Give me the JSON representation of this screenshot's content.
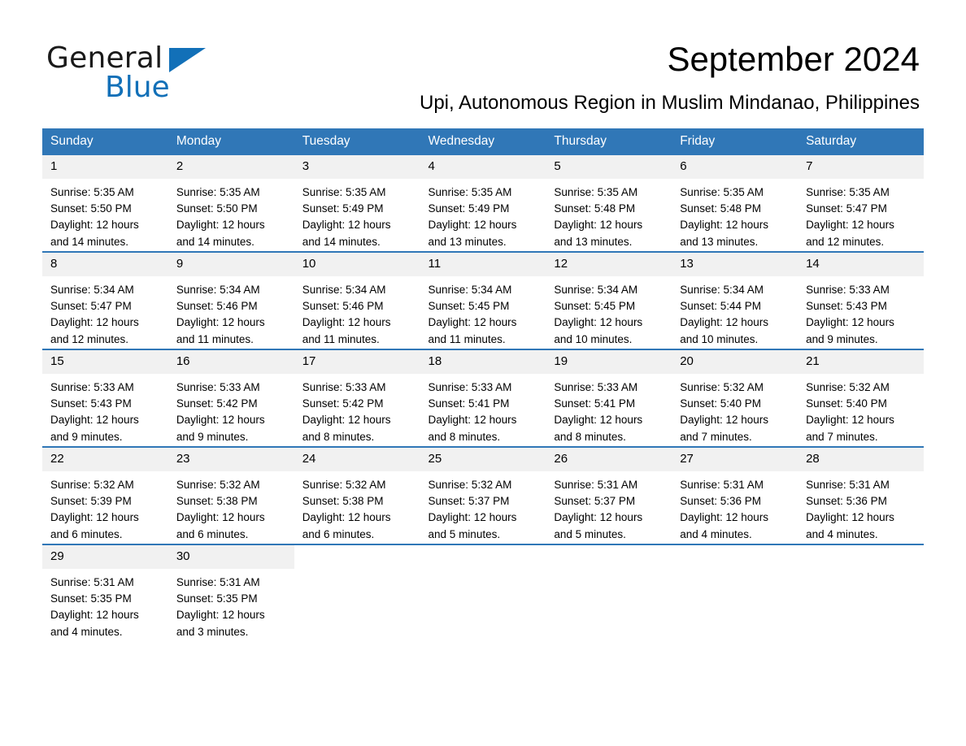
{
  "brand": {
    "word_general": "General",
    "word_blue": "Blue",
    "triangle_color": "#1270b8",
    "accent_color": "#3077b7"
  },
  "header": {
    "title": "September 2024",
    "subtitle": "Upi, Autonomous Region in Muslim Mindanao, Philippines"
  },
  "calendar": {
    "weekday_headers": [
      "Sunday",
      "Monday",
      "Tuesday",
      "Wednesday",
      "Thursday",
      "Friday",
      "Saturday"
    ],
    "weeks": [
      [
        {
          "day": "1",
          "sunrise": "Sunrise: 5:35 AM",
          "sunset": "Sunset: 5:50 PM",
          "daylight_l1": "Daylight: 12 hours",
          "daylight_l2": "and 14 minutes."
        },
        {
          "day": "2",
          "sunrise": "Sunrise: 5:35 AM",
          "sunset": "Sunset: 5:50 PM",
          "daylight_l1": "Daylight: 12 hours",
          "daylight_l2": "and 14 minutes."
        },
        {
          "day": "3",
          "sunrise": "Sunrise: 5:35 AM",
          "sunset": "Sunset: 5:49 PM",
          "daylight_l1": "Daylight: 12 hours",
          "daylight_l2": "and 14 minutes."
        },
        {
          "day": "4",
          "sunrise": "Sunrise: 5:35 AM",
          "sunset": "Sunset: 5:49 PM",
          "daylight_l1": "Daylight: 12 hours",
          "daylight_l2": "and 13 minutes."
        },
        {
          "day": "5",
          "sunrise": "Sunrise: 5:35 AM",
          "sunset": "Sunset: 5:48 PM",
          "daylight_l1": "Daylight: 12 hours",
          "daylight_l2": "and 13 minutes."
        },
        {
          "day": "6",
          "sunrise": "Sunrise: 5:35 AM",
          "sunset": "Sunset: 5:48 PM",
          "daylight_l1": "Daylight: 12 hours",
          "daylight_l2": "and 13 minutes."
        },
        {
          "day": "7",
          "sunrise": "Sunrise: 5:35 AM",
          "sunset": "Sunset: 5:47 PM",
          "daylight_l1": "Daylight: 12 hours",
          "daylight_l2": "and 12 minutes."
        }
      ],
      [
        {
          "day": "8",
          "sunrise": "Sunrise: 5:34 AM",
          "sunset": "Sunset: 5:47 PM",
          "daylight_l1": "Daylight: 12 hours",
          "daylight_l2": "and 12 minutes."
        },
        {
          "day": "9",
          "sunrise": "Sunrise: 5:34 AM",
          "sunset": "Sunset: 5:46 PM",
          "daylight_l1": "Daylight: 12 hours",
          "daylight_l2": "and 11 minutes."
        },
        {
          "day": "10",
          "sunrise": "Sunrise: 5:34 AM",
          "sunset": "Sunset: 5:46 PM",
          "daylight_l1": "Daylight: 12 hours",
          "daylight_l2": "and 11 minutes."
        },
        {
          "day": "11",
          "sunrise": "Sunrise: 5:34 AM",
          "sunset": "Sunset: 5:45 PM",
          "daylight_l1": "Daylight: 12 hours",
          "daylight_l2": "and 11 minutes."
        },
        {
          "day": "12",
          "sunrise": "Sunrise: 5:34 AM",
          "sunset": "Sunset: 5:45 PM",
          "daylight_l1": "Daylight: 12 hours",
          "daylight_l2": "and 10 minutes."
        },
        {
          "day": "13",
          "sunrise": "Sunrise: 5:34 AM",
          "sunset": "Sunset: 5:44 PM",
          "daylight_l1": "Daylight: 12 hours",
          "daylight_l2": "and 10 minutes."
        },
        {
          "day": "14",
          "sunrise": "Sunrise: 5:33 AM",
          "sunset": "Sunset: 5:43 PM",
          "daylight_l1": "Daylight: 12 hours",
          "daylight_l2": "and 9 minutes."
        }
      ],
      [
        {
          "day": "15",
          "sunrise": "Sunrise: 5:33 AM",
          "sunset": "Sunset: 5:43 PM",
          "daylight_l1": "Daylight: 12 hours",
          "daylight_l2": "and 9 minutes."
        },
        {
          "day": "16",
          "sunrise": "Sunrise: 5:33 AM",
          "sunset": "Sunset: 5:42 PM",
          "daylight_l1": "Daylight: 12 hours",
          "daylight_l2": "and 9 minutes."
        },
        {
          "day": "17",
          "sunrise": "Sunrise: 5:33 AM",
          "sunset": "Sunset: 5:42 PM",
          "daylight_l1": "Daylight: 12 hours",
          "daylight_l2": "and 8 minutes."
        },
        {
          "day": "18",
          "sunrise": "Sunrise: 5:33 AM",
          "sunset": "Sunset: 5:41 PM",
          "daylight_l1": "Daylight: 12 hours",
          "daylight_l2": "and 8 minutes."
        },
        {
          "day": "19",
          "sunrise": "Sunrise: 5:33 AM",
          "sunset": "Sunset: 5:41 PM",
          "daylight_l1": "Daylight: 12 hours",
          "daylight_l2": "and 8 minutes."
        },
        {
          "day": "20",
          "sunrise": "Sunrise: 5:32 AM",
          "sunset": "Sunset: 5:40 PM",
          "daylight_l1": "Daylight: 12 hours",
          "daylight_l2": "and 7 minutes."
        },
        {
          "day": "21",
          "sunrise": "Sunrise: 5:32 AM",
          "sunset": "Sunset: 5:40 PM",
          "daylight_l1": "Daylight: 12 hours",
          "daylight_l2": "and 7 minutes."
        }
      ],
      [
        {
          "day": "22",
          "sunrise": "Sunrise: 5:32 AM",
          "sunset": "Sunset: 5:39 PM",
          "daylight_l1": "Daylight: 12 hours",
          "daylight_l2": "and 6 minutes."
        },
        {
          "day": "23",
          "sunrise": "Sunrise: 5:32 AM",
          "sunset": "Sunset: 5:38 PM",
          "daylight_l1": "Daylight: 12 hours",
          "daylight_l2": "and 6 minutes."
        },
        {
          "day": "24",
          "sunrise": "Sunrise: 5:32 AM",
          "sunset": "Sunset: 5:38 PM",
          "daylight_l1": "Daylight: 12 hours",
          "daylight_l2": "and 6 minutes."
        },
        {
          "day": "25",
          "sunrise": "Sunrise: 5:32 AM",
          "sunset": "Sunset: 5:37 PM",
          "daylight_l1": "Daylight: 12 hours",
          "daylight_l2": "and 5 minutes."
        },
        {
          "day": "26",
          "sunrise": "Sunrise: 5:31 AM",
          "sunset": "Sunset: 5:37 PM",
          "daylight_l1": "Daylight: 12 hours",
          "daylight_l2": "and 5 minutes."
        },
        {
          "day": "27",
          "sunrise": "Sunrise: 5:31 AM",
          "sunset": "Sunset: 5:36 PM",
          "daylight_l1": "Daylight: 12 hours",
          "daylight_l2": "and 4 minutes."
        },
        {
          "day": "28",
          "sunrise": "Sunrise: 5:31 AM",
          "sunset": "Sunset: 5:36 PM",
          "daylight_l1": "Daylight: 12 hours",
          "daylight_l2": "and 4 minutes."
        }
      ],
      [
        {
          "day": "29",
          "sunrise": "Sunrise: 5:31 AM",
          "sunset": "Sunset: 5:35 PM",
          "daylight_l1": "Daylight: 12 hours",
          "daylight_l2": "and 4 minutes."
        },
        {
          "day": "30",
          "sunrise": "Sunrise: 5:31 AM",
          "sunset": "Sunset: 5:35 PM",
          "daylight_l1": "Daylight: 12 hours",
          "daylight_l2": "and 3 minutes."
        },
        {
          "day": "",
          "sunrise": "",
          "sunset": "",
          "daylight_l1": "",
          "daylight_l2": ""
        },
        {
          "day": "",
          "sunrise": "",
          "sunset": "",
          "daylight_l1": "",
          "daylight_l2": ""
        },
        {
          "day": "",
          "sunrise": "",
          "sunset": "",
          "daylight_l1": "",
          "daylight_l2": ""
        },
        {
          "day": "",
          "sunrise": "",
          "sunset": "",
          "daylight_l1": "",
          "daylight_l2": ""
        },
        {
          "day": "",
          "sunrise": "",
          "sunset": "",
          "daylight_l1": "",
          "daylight_l2": ""
        }
      ]
    ]
  }
}
